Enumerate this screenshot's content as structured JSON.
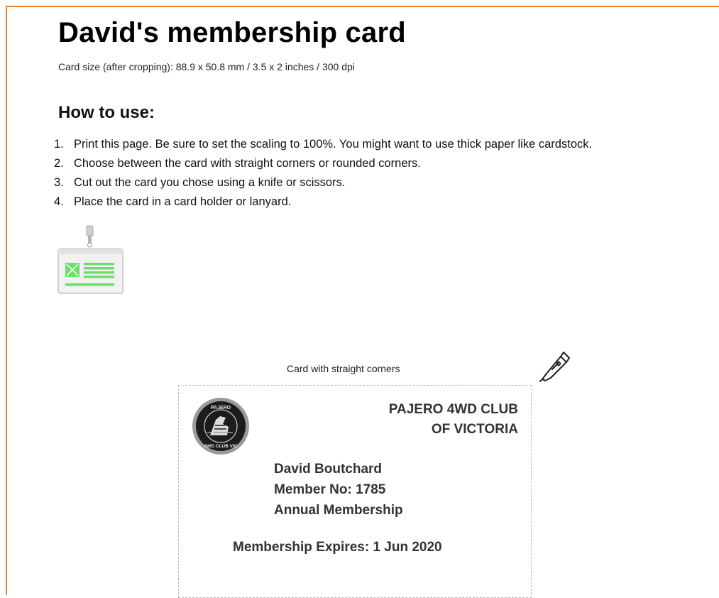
{
  "document": {
    "title": "David's membership card",
    "card_size_note": "Card size (after cropping): 88.9 x 50.8 mm / 3.5 x 2 inches / 300 dpi"
  },
  "instructions": {
    "heading": "How to use:",
    "steps": [
      {
        "num": "1.",
        "text": "Print this page. Be sure to set the scaling to 100%. You might want to use thick paper like cardstock."
      },
      {
        "num": "2.",
        "text": "Choose between the card with straight corners or rounded corners."
      },
      {
        "num": "3.",
        "text": "Cut out the card you chose using a knife or scissors."
      },
      {
        "num": "4.",
        "text": "Place the card in a card holder or lanyard."
      }
    ]
  },
  "card_section": {
    "caption": "Card with straight corners"
  },
  "card": {
    "club_name_line1": "PAJERO 4WD CLUB",
    "club_name_line2": "OF VICTORIA",
    "logo_text_top": "PAJERO",
    "logo_text_bottom": "4WD CLUB VIC",
    "member_name": "David Boutchard",
    "member_number": "Member No: 1785",
    "membership_type": "Annual Membership",
    "expiry": "Membership Expires: 1 Jun 2020"
  },
  "icons": {
    "badge_holder": "id-badge-holder-icon",
    "cutter": "craft-knife-icon"
  },
  "colors": {
    "frame_border": "#e8843a",
    "badge_green": "#6fdc6f",
    "card_border": "#b8b8b8"
  }
}
